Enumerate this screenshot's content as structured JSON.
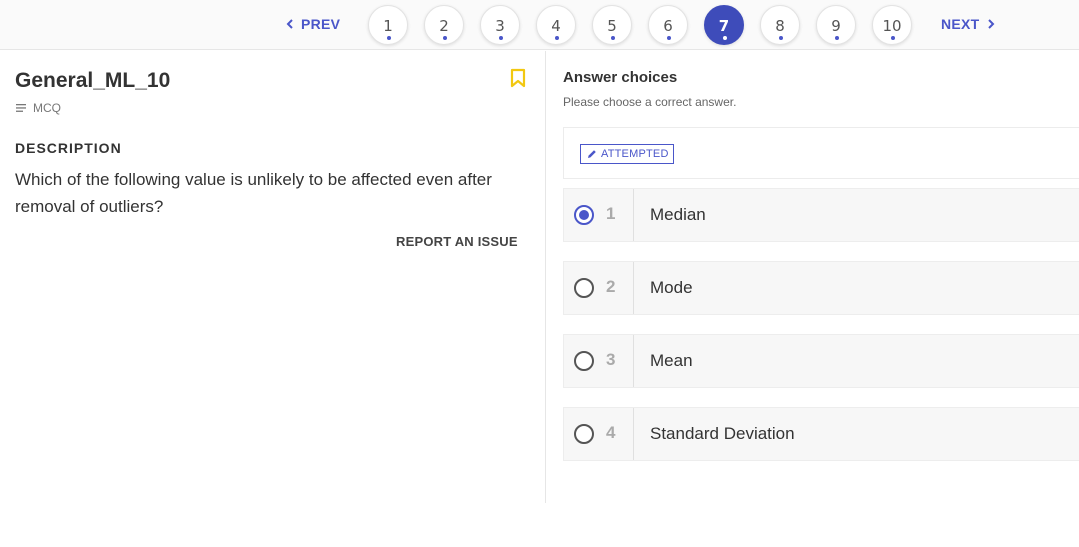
{
  "pagination": {
    "prev_label": "PREV",
    "next_label": "NEXT",
    "pages": [
      "1",
      "2",
      "3",
      "4",
      "5",
      "6",
      "7",
      "8",
      "9",
      "10"
    ],
    "active_page": "7"
  },
  "question": {
    "title": "General_ML_10",
    "type": "MCQ",
    "description_heading": "DESCRIPTION",
    "description": "Which of the following value is unlikely to be affected even after removal of outliers?",
    "report_label": "REPORT AN ISSUE",
    "bookmark_icon": "bookmark-icon"
  },
  "answers": {
    "title": "Answer choices",
    "subtitle": "Please choose a correct answer.",
    "status_badge": "ATTEMPTED",
    "choices": [
      {
        "index": "1",
        "label": "Median",
        "selected": true
      },
      {
        "index": "2",
        "label": "Mode",
        "selected": false
      },
      {
        "index": "3",
        "label": "Mean",
        "selected": false
      },
      {
        "index": "4",
        "label": "Standard Deviation",
        "selected": false
      }
    ]
  },
  "colors": {
    "accent": "#3e4cba",
    "bookmark": "#f2c811"
  }
}
